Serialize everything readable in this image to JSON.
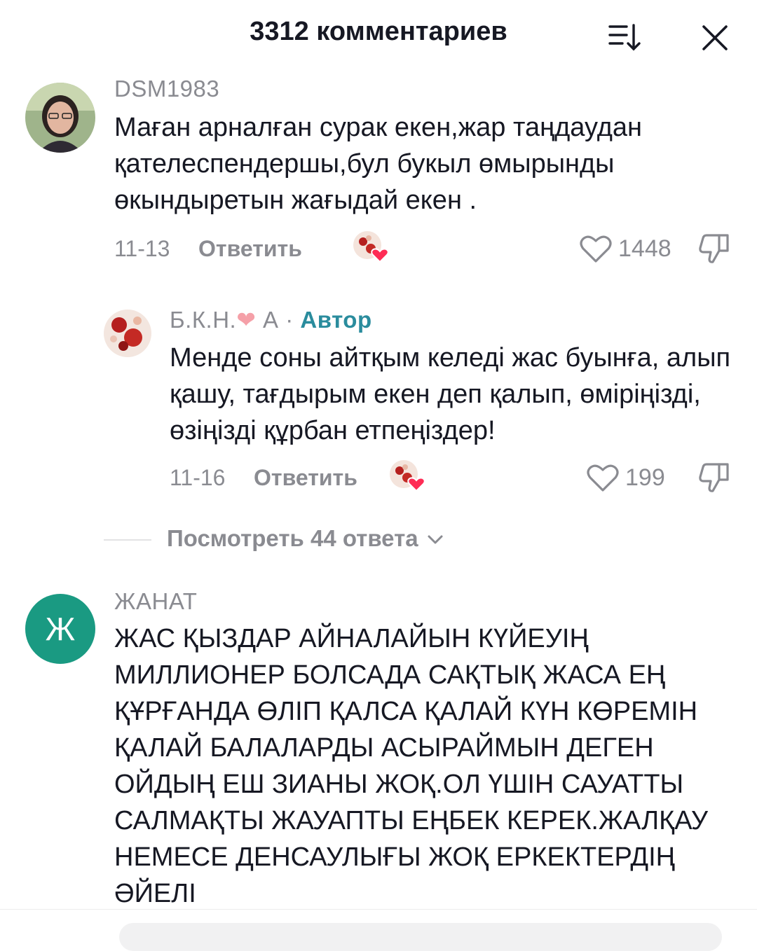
{
  "header": {
    "title": "3312 комментариев",
    "sort_icon": "sort-descending-icon",
    "close_icon": "close-icon"
  },
  "comments": [
    {
      "username": "DSM1983",
      "text": "Маған арналған сурак екен,жар таңдаудан қателеспендершы,бул букыл өмырынды өкындыретын жағыдай екен .",
      "date": "11-13",
      "reply_label": "Ответить",
      "likes": "1448",
      "liked_by_author": true
    },
    {
      "username": "Б.К.Н.",
      "username_heart": "❤",
      "username_suffix": " А · ",
      "author_tag": "Автор",
      "text": "Менде соны айтқым келеді жас буынға, алып қашу, тағдырым екен деп қалып, өміріңізді, өзіңізді құрбан етпеңіздер!",
      "date": "11-16",
      "reply_label": "Ответить",
      "likes": "199",
      "liked_by_author": true
    },
    {
      "username": "ЖАНАТ",
      "avatar_letter": "Ж",
      "text": "ЖАС ҚЫЗДАР АЙНАЛАЙЫН КҮЙЕУІҢ МИЛЛИОНЕР БОЛСАДА САҚТЫҚ ЖАСА ЕҢ ҚҰРҒАНДА ӨЛІП ҚАЛСА ҚАЛАЙ КҮН КӨРЕМІН ҚАЛАЙ БАЛАЛАРДЫ АСЫРАЙМЫН ДЕГЕН ОЙДЫҢ ЕШ ЗИАНЫ ЖОҚ.ОЛ ҮШІН САУАТТЫ САЛМАҚТЫ ЖАУАПТЫ ЕҢБЕК КЕРЕК.ЖАЛҚАУ НЕМЕСЕ ДЕНСАУЛЫҒЫ ЖОҚ ЕРКЕКТЕРДІҢ ӘЙЕЛІ"
    }
  ],
  "view_replies": {
    "label": "Посмотреть 44 ответа",
    "icon": "chevron-down-icon"
  },
  "colors": {
    "text": "#161823",
    "muted": "#8a8b91",
    "author_tag": "#2a8c9d",
    "avatar_green": "#1a9a82",
    "like_heart": "#fe2c55"
  }
}
